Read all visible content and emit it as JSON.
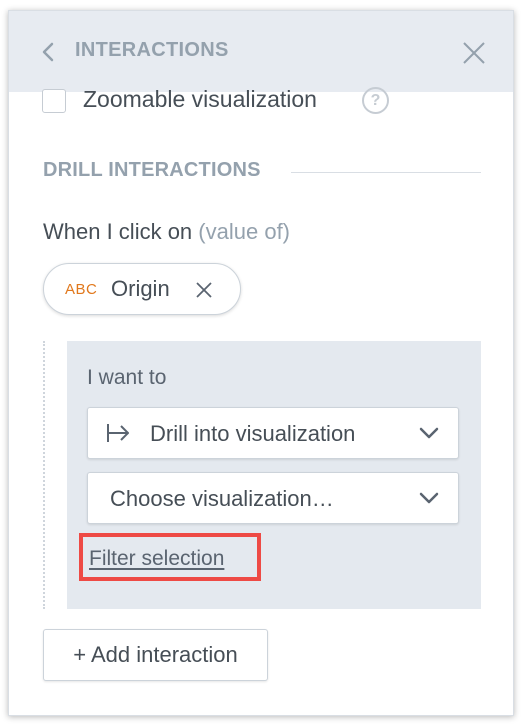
{
  "header": {
    "title": "INTERACTIONS",
    "back_icon": "chevron-left-icon",
    "close_icon": "close-icon"
  },
  "zoom": {
    "label": "Zoomable visualization",
    "checked": false,
    "help_glyph": "?"
  },
  "section": {
    "title": "DRILL INTERACTIONS"
  },
  "trigger": {
    "label": "When I click on",
    "hint": "(value of)",
    "chip": {
      "type": "ABC",
      "label": "Origin"
    }
  },
  "action": {
    "label": "I want to",
    "action_select": {
      "value": "Drill into visualization",
      "icon": "drill-arrow-icon"
    },
    "target_select": {
      "value": "Choose visualization…"
    },
    "filter_link": "Filter selection"
  },
  "footer": {
    "add_button": "+ Add interaction"
  },
  "colors": {
    "header_bg": "#e7ebf1",
    "muted": "#94a1ad",
    "text": "#464e56",
    "attribute_orange": "#e1781c",
    "highlight_red": "#ee4a45",
    "box_bg": "#e4e9ef"
  }
}
